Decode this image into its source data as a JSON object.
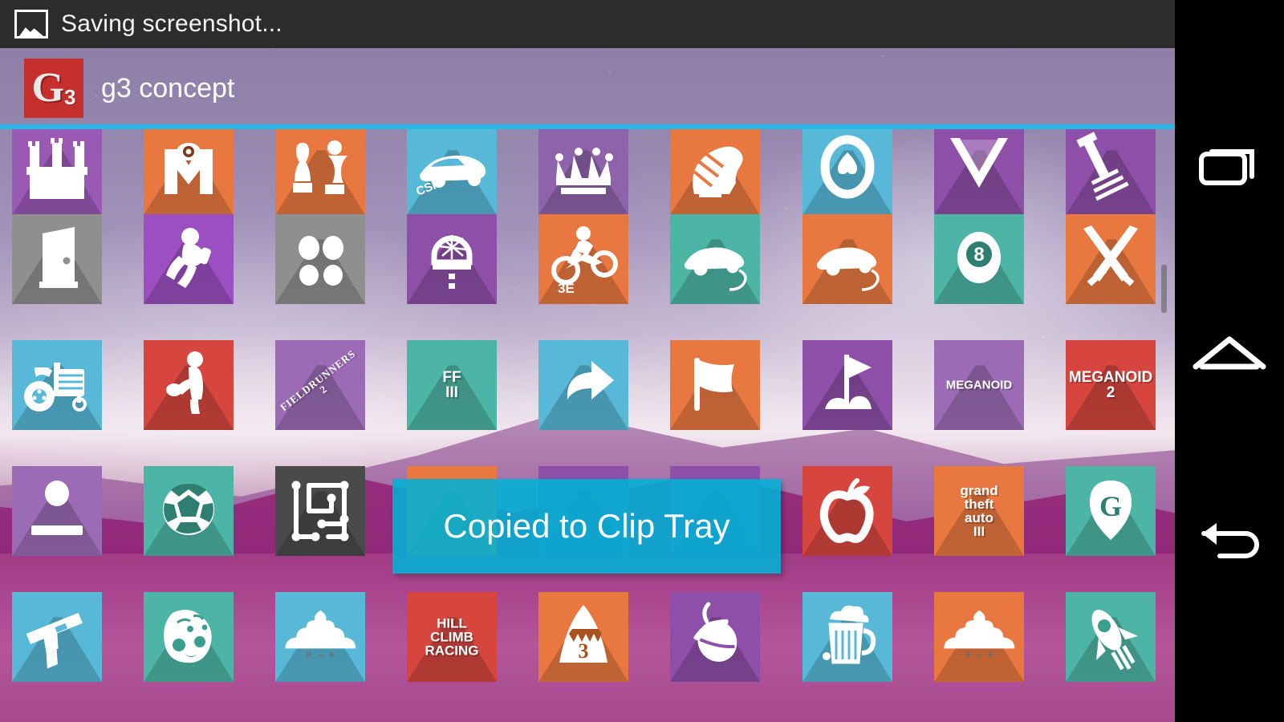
{
  "status_bar": {
    "icon": "image-icon",
    "text": "Saving screenshot..."
  },
  "drawer_header": {
    "logo_letter": "G",
    "logo_sub": "3",
    "title": "g3 concept",
    "accent_color": "#29b6e8",
    "logo_bg": "#c6302c"
  },
  "toast": {
    "message": "Copied to Clip Tray",
    "bg_color": "#00b2d6",
    "text_color": "#ffffff"
  },
  "nav_bar": {
    "recents_label": "recents-icon",
    "home_label": "home-icon",
    "back_label": "back-icon"
  },
  "grid": {
    "columns": 9,
    "rows": 5,
    "icons": [
      {
        "r": 0,
        "c": 0,
        "name": "castle-icon",
        "bg": "#9b59b6",
        "glyph": "castle",
        "label": ""
      },
      {
        "r": 0,
        "c": 1,
        "name": "monsters-icon",
        "bg": "#e87840",
        "glyph": "monster-m",
        "label": ""
      },
      {
        "r": 0,
        "c": 2,
        "name": "chess-icon",
        "bg": "#e87840",
        "glyph": "chess",
        "label": ""
      },
      {
        "r": 0,
        "c": 3,
        "name": "csr-racing-icon",
        "bg": "#57b8d8",
        "glyph": "csr-car",
        "label": "CSR"
      },
      {
        "r": 0,
        "c": 4,
        "name": "crown-icon",
        "bg": "#8e63ab",
        "glyph": "crown",
        "label": ""
      },
      {
        "r": 0,
        "c": 5,
        "name": "horse-icon",
        "bg": "#e87840",
        "glyph": "horse",
        "label": ""
      },
      {
        "r": 0,
        "c": 6,
        "name": "spade-icon",
        "bg": "#57b8d8",
        "glyph": "spade-ring",
        "label": ""
      },
      {
        "r": 0,
        "c": 7,
        "name": "chevron-icon",
        "bg": "#8e4fa8",
        "glyph": "v-chevron",
        "label": ""
      },
      {
        "r": 0,
        "c": 8,
        "name": "guitar-icon",
        "bg": "#8e4fa8",
        "glyph": "guitar",
        "label": ""
      },
      {
        "r": 1,
        "c": 0,
        "name": "door-icon",
        "bg": "#8f8f8f",
        "glyph": "door",
        "label": ""
      },
      {
        "r": 1,
        "c": 1,
        "name": "jetpack-joyride-icon",
        "bg": "#9b4fc0",
        "glyph": "jetpack-man",
        "label": ""
      },
      {
        "r": 1,
        "c": 2,
        "name": "four-dots-icon",
        "bg": "#8f8f8f",
        "glyph": "four-dots",
        "label": ""
      },
      {
        "r": 1,
        "c": 3,
        "name": "road-arch-icon",
        "bg": "#8e4fa8",
        "glyph": "road-arch",
        "label": ""
      },
      {
        "r": 1,
        "c": 4,
        "name": "trial-xtreme-icon",
        "bg": "#e87840",
        "glyph": "moto",
        "label": "3E"
      },
      {
        "r": 1,
        "c": 5,
        "name": "racing-car-teal-icon",
        "bg": "#4cb5a5",
        "glyph": "car",
        "label": ""
      },
      {
        "r": 1,
        "c": 6,
        "name": "racing-car-orange-icon",
        "bg": "#e87840",
        "glyph": "car",
        "label": ""
      },
      {
        "r": 1,
        "c": 7,
        "name": "eight-ball-icon",
        "bg": "#4cb5a5",
        "glyph": "eight-ball",
        "label": ""
      },
      {
        "r": 1,
        "c": 8,
        "name": "swords-icon",
        "bg": "#e87840",
        "glyph": "swords",
        "label": ""
      },
      {
        "r": 2,
        "c": 0,
        "name": "tractor-icon",
        "bg": "#57b8d8",
        "glyph": "tractor",
        "label": ""
      },
      {
        "r": 2,
        "c": 1,
        "name": "bowler-icon",
        "bg": "#d6463f",
        "glyph": "person",
        "label": ""
      },
      {
        "r": 2,
        "c": 2,
        "name": "fieldrunners-2-icon",
        "bg": "#9b6cb5",
        "glyph": "text-diag",
        "label": "FIELDRUNNERS 2"
      },
      {
        "r": 2,
        "c": 3,
        "name": "final-fantasy-iii-icon",
        "bg": "#4cb5a5",
        "glyph": "text",
        "label": "FF III"
      },
      {
        "r": 2,
        "c": 4,
        "name": "arrow-icon",
        "bg": "#57b8d8",
        "glyph": "arrow",
        "label": ""
      },
      {
        "r": 2,
        "c": 5,
        "name": "flag-icon",
        "bg": "#e87840",
        "glyph": "flag",
        "label": ""
      },
      {
        "r": 2,
        "c": 6,
        "name": "golf-flag-icon",
        "bg": "#8e4fa8",
        "glyph": "golf-flag",
        "label": ""
      },
      {
        "r": 2,
        "c": 7,
        "name": "meganoid-icon",
        "bg": "#9b6cb5",
        "glyph": "text",
        "label": "MEGANOID"
      },
      {
        "r": 2,
        "c": 8,
        "name": "meganoid-2-icon",
        "bg": "#d6463f",
        "glyph": "text",
        "label": "MEGANOID 2"
      },
      {
        "r": 3,
        "c": 0,
        "name": "ball-paddle-icon",
        "bg": "#9b6cb5",
        "glyph": "ball-paddle",
        "label": ""
      },
      {
        "r": 3,
        "c": 1,
        "name": "soccer-ball-icon",
        "bg": "#4cb5a5",
        "glyph": "soccer",
        "label": ""
      },
      {
        "r": 3,
        "c": 2,
        "name": "flow-puzzle-icon",
        "bg": "#4a4a4a",
        "glyph": "flow",
        "label": ""
      },
      {
        "r": 3,
        "c": 3,
        "name": "hidden-icon-orange",
        "bg": "#e87840",
        "glyph": "none",
        "label": ""
      },
      {
        "r": 3,
        "c": 4,
        "name": "hidden-icon-purple-a",
        "bg": "#8e4fa8",
        "glyph": "none",
        "label": ""
      },
      {
        "r": 3,
        "c": 5,
        "name": "hidden-icon-purple-b",
        "bg": "#8e4fa8",
        "glyph": "none",
        "label": ""
      },
      {
        "r": 3,
        "c": 6,
        "name": "apple-icon",
        "bg": "#d6463f",
        "glyph": "apple",
        "label": ""
      },
      {
        "r": 3,
        "c": 7,
        "name": "grand-theft-auto-iii-icon",
        "bg": "#e87840",
        "glyph": "text",
        "label": "grand theft auto III"
      },
      {
        "r": 3,
        "c": 8,
        "name": "guitar-pick-icon",
        "bg": "#4cb5a5",
        "glyph": "pick-g",
        "label": ""
      },
      {
        "r": 4,
        "c": 0,
        "name": "pistol-icon",
        "bg": "#57b8d8",
        "glyph": "gun",
        "label": ""
      },
      {
        "r": 4,
        "c": 1,
        "name": "creature-face-icon",
        "bg": "#4cb5a5",
        "glyph": "creature",
        "label": ""
      },
      {
        "r": 4,
        "c": 2,
        "name": "poop-blue-icon",
        "bg": "#57b8d8",
        "glyph": "poop",
        "label": ""
      },
      {
        "r": 4,
        "c": 3,
        "name": "hill-climb-racing-icon",
        "bg": "#d6463f",
        "glyph": "text",
        "label": "HILL CLIMB RACING"
      },
      {
        "r": 4,
        "c": 4,
        "name": "hungry-shark-3-icon",
        "bg": "#e87840",
        "glyph": "shark",
        "label": "3"
      },
      {
        "r": 4,
        "c": 5,
        "name": "acorn-icon",
        "bg": "#8e4fa8",
        "glyph": "acorn",
        "label": ""
      },
      {
        "r": 4,
        "c": 6,
        "name": "beer-mug-icon",
        "bg": "#57b8d8",
        "glyph": "beer",
        "label": ""
      },
      {
        "r": 4,
        "c": 7,
        "name": "poop-orange-icon",
        "bg": "#e87840",
        "glyph": "poop",
        "label": ""
      },
      {
        "r": 4,
        "c": 8,
        "name": "rocket-icon",
        "bg": "#4cb5a5",
        "glyph": "rocket",
        "label": ""
      }
    ]
  }
}
